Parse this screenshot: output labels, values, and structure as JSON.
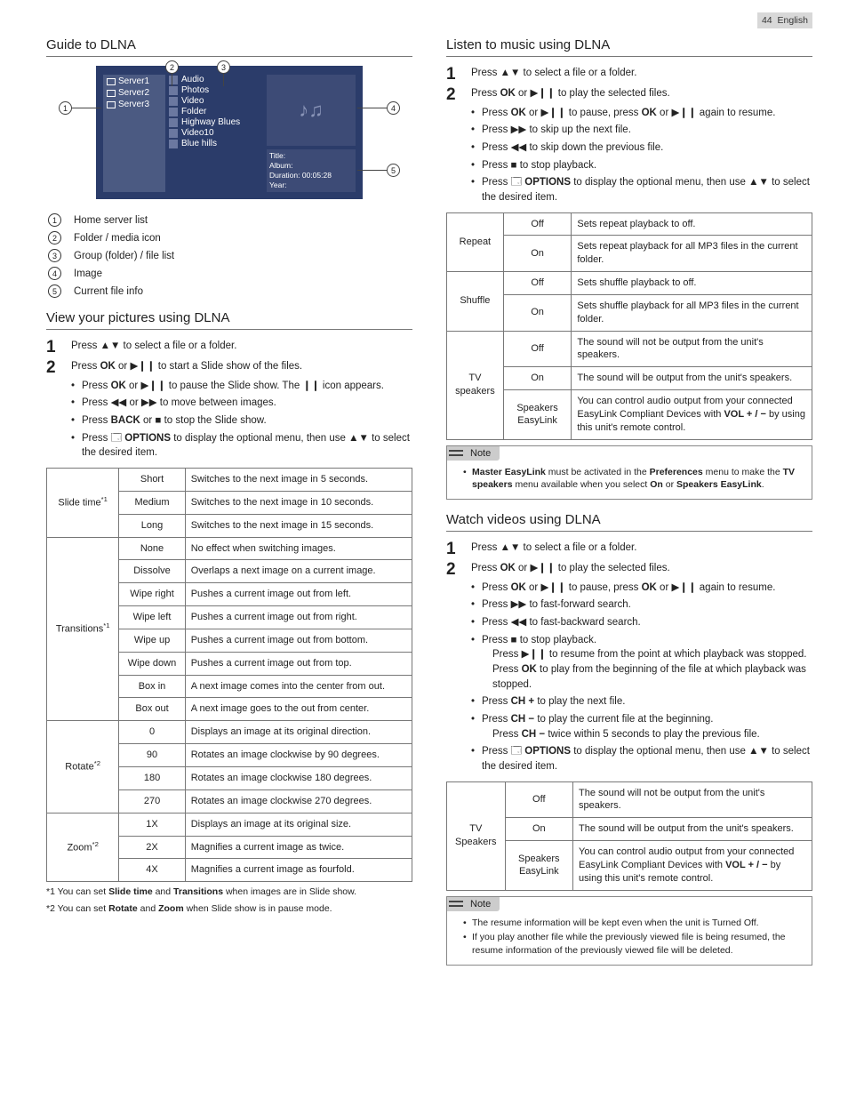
{
  "page_header": {
    "num": "44",
    "lang": "English"
  },
  "left": {
    "section1": {
      "title": "Guide to DLNA",
      "diagram": {
        "servers": [
          "Server1",
          "Server2",
          "Server3"
        ],
        "media": [
          "Audio",
          "Photos",
          "Video",
          "Folder",
          "Highway Blues",
          "Video10",
          "Blue hills"
        ],
        "info": [
          "Title:",
          "Album:",
          "Duration: 00:05:28",
          "Year:"
        ]
      },
      "legend": [
        {
          "n": "1",
          "t": "Home server list"
        },
        {
          "n": "2",
          "t": "Folder / media icon"
        },
        {
          "n": "3",
          "t": "Group (folder) / file list"
        },
        {
          "n": "4",
          "t": "Image"
        },
        {
          "n": "5",
          "t": "Current file info"
        }
      ]
    },
    "section2": {
      "title": "View your pictures using DLNA",
      "step1": "Press ▲▼ to select a file or a folder.",
      "step2_main_a": "Press ",
      "step2_main_b": " or ▶❙❙ to start a Slide show of the files.",
      "ok": "OK",
      "back": "BACK",
      "options": "OPTIONS",
      "sub": [
        {
          "a": "Press ",
          "b": " or ▶❙❙ to pause the Slide show. The ❙❙ icon appears."
        },
        {
          "a": "Press ◀◀ or ▶▶ to move between images."
        },
        {
          "a": "Press ",
          "b": " or ■ to stop the Slide show."
        },
        {
          "a": "Press ",
          "b": " to display the optional menu, then use ▲▼ to select the desired item."
        }
      ],
      "tableSlideTime": {
        "label": "Slide time",
        "sup": "*1",
        "rows": [
          [
            "Short",
            "Switches to the next image in 5 seconds."
          ],
          [
            "Medium",
            "Switches to the next image in 10 seconds."
          ],
          [
            "Long",
            "Switches to the next image in 15 seconds."
          ]
        ]
      },
      "tableTransitions": {
        "label": "Transitions",
        "sup": "*1",
        "rows": [
          [
            "None",
            "No effect when switching images."
          ],
          [
            "Dissolve",
            "Overlaps a next image on a current image."
          ],
          [
            "Wipe right",
            "Pushes a current image out from left."
          ],
          [
            "Wipe left",
            "Pushes a current image out from right."
          ],
          [
            "Wipe up",
            "Pushes a current image out from bottom."
          ],
          [
            "Wipe down",
            "Pushes a current image out from top."
          ],
          [
            "Box in",
            "A next image comes into the center from out."
          ],
          [
            "Box out",
            "A next image goes to the out from center."
          ]
        ]
      },
      "tableRotate": {
        "label": "Rotate",
        "sup": "*2",
        "rows": [
          [
            "0",
            "Displays an image at its original direction."
          ],
          [
            "90",
            "Rotates an image clockwise by 90 degrees."
          ],
          [
            "180",
            "Rotates an image clockwise 180 degrees."
          ],
          [
            "270",
            "Rotates an image clockwise 270 degrees."
          ]
        ]
      },
      "tableZoom": {
        "label": "Zoom",
        "sup": "*2",
        "rows": [
          [
            "1X",
            "Displays an image at its original size."
          ],
          [
            "2X",
            "Magnifies a current image as twice."
          ],
          [
            "4X",
            "Magnifies a current image as fourfold."
          ]
        ]
      },
      "footnotes": [
        {
          "a": "*1 You can set ",
          "b": "Slide time",
          "c": " and ",
          "d": "Transitions",
          "e": " when images are in Slide show."
        },
        {
          "a": "*2 You can set ",
          "b": "Rotate",
          "c": " and ",
          "d": "Zoom",
          "e": " when Slide show is in pause mode."
        }
      ]
    }
  },
  "right": {
    "section1": {
      "title": "Listen to music using DLNA",
      "step1": "Press ▲▼ to select a file or a folder.",
      "step2_a": "Press ",
      "step2_b": " or ▶❙❙ to play the selected files.",
      "ok": "OK",
      "options": "OPTIONS",
      "sub": [
        "Press <b>OK</b> or ▶❙❙ to pause, press <b>OK</b> or ▶❙❙ again to resume.",
        "Press ▶▶ to skip up the next file.",
        "Press ◀◀ to skip down the previous file.",
        "Press ■ to stop playback.",
        "Press 🗔 <b>OPTIONS</b> to display the optional menu, then use ▲▼ to select the desired item."
      ],
      "tableRepeat": {
        "label": "Repeat",
        "rows": [
          [
            "Off",
            "Sets repeat playback to off."
          ],
          [
            "On",
            "Sets repeat playback for all MP3 files in the current folder."
          ]
        ]
      },
      "tableShuffle": {
        "label": "Shuffle",
        "rows": [
          [
            "Off",
            "Sets shuffle playback to off."
          ],
          [
            "On",
            "Sets shuffle playback for all MP3 files in the current folder."
          ]
        ]
      },
      "tableTvSpk": {
        "label": "TV speakers",
        "rows": [
          [
            "Off",
            "The sound will not be output from the unit's speakers."
          ],
          [
            "On",
            "The sound will be output from the unit's speakers."
          ],
          [
            "Speakers EasyLink",
            "You can control audio output from your connected EasyLink Compliant Devices with <b>VOL + / −</b> by using this unit's remote control."
          ]
        ]
      },
      "note_label": "Note",
      "note": "<b>Master EasyLink</b> must be activated in the <b>Preferences</b> menu to make the <b>TV speakers</b> menu available when you select <b>On</b> or <b>Speakers EasyLink</b>."
    },
    "section2": {
      "title": "Watch videos using DLNA",
      "step1": "Press ▲▼ to select a file or a folder.",
      "step2_a": "Press ",
      "step2_b": " or ▶❙❙ to play the selected files.",
      "ok": "OK",
      "options": "OPTIONS",
      "sub_html": [
        "Press <b>OK</b> or ▶❙❙ to pause, press <b>OK</b> or ▶❙❙ again to resume.",
        "Press ▶▶ to fast-forward search.",
        "Press ◀◀ to fast-backward search.",
        "Press ■ to stop playback.<div class='indent-nobullet'>Press ▶❙❙ to resume from the point at which playback was stopped. Press <b>OK</b> to play from the beginning of the file at which playback was stopped.</div>",
        "Press <b>CH +</b> to play the next file.",
        "Press <b>CH −</b> to play the current file at the beginning.<div class='indent-nobullet'>Press <b>CH −</b> twice within 5 seconds to play the previous file.</div>",
        "Press 🗔 <b>OPTIONS</b> to display the optional menu, then use ▲▼ to select the desired item."
      ],
      "tableTvSpk": {
        "label": "TV Speakers",
        "rows": [
          [
            "Off",
            "The sound will not be output from the unit's speakers."
          ],
          [
            "On",
            "The sound will be output from the unit's speakers."
          ],
          [
            "Speakers EasyLink",
            "You can control audio output from your connected EasyLink Compliant Devices with <b>VOL + / −</b> by using this unit's remote control."
          ]
        ]
      },
      "note_label": "Note",
      "notes": [
        "The resume information will be kept even when the unit is Turned Off.",
        "If you play another file while the previously viewed file is being resumed, the resume information of the previously viewed file will be deleted."
      ]
    }
  }
}
